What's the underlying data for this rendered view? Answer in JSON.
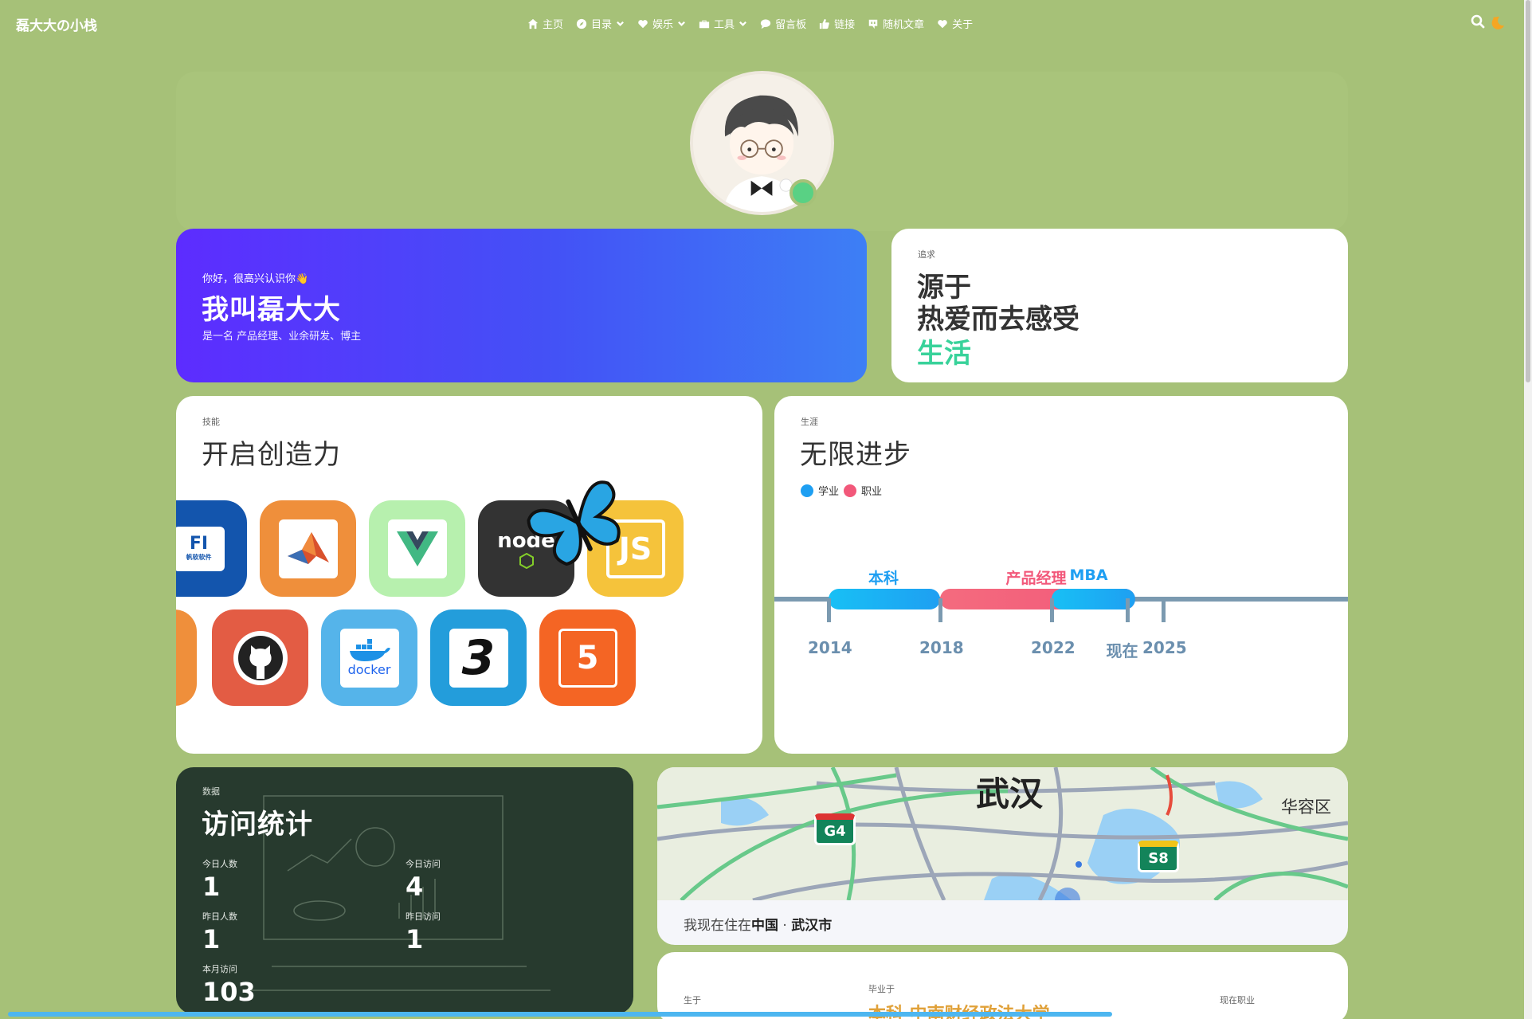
{
  "brand": "磊大大の小栈",
  "menu": [
    {
      "label": "主页",
      "icon": "home-icon",
      "dropdown": false
    },
    {
      "label": "目录",
      "icon": "compass-icon",
      "dropdown": true
    },
    {
      "label": "娱乐",
      "icon": "heart-icon",
      "dropdown": true
    },
    {
      "label": "工具",
      "icon": "toolbox-icon",
      "dropdown": true
    },
    {
      "label": "留言板",
      "icon": "comment-icon",
      "dropdown": false
    },
    {
      "label": "链接",
      "icon": "thumbs-up-icon",
      "dropdown": false
    },
    {
      "label": "随机文章",
      "icon": "random-icon",
      "dropdown": false
    },
    {
      "label": "关于",
      "icon": "heart-icon",
      "dropdown": false
    }
  ],
  "intro": {
    "greeting": "你好，很高兴认识你👋",
    "name": "我叫磊大大",
    "description": "是一名 产品经理、业余研发、博主"
  },
  "pursuit": {
    "tag": "追求",
    "line1": "源于",
    "line2": "热爱而去感受",
    "line3": "生活"
  },
  "skills": {
    "tag": "技能",
    "title": "开启创造力",
    "row1": [
      {
        "name": "FineReport",
        "label": "帆软软件",
        "bg": "#1355ad"
      },
      {
        "name": "MATLAB",
        "label": "",
        "bg": "#ef8f3b"
      },
      {
        "name": "Vue",
        "label": "",
        "bg": "#b7f0ae"
      },
      {
        "name": "Node.js",
        "label": "node",
        "bg": "#333333"
      },
      {
        "name": "JavaScript",
        "label": "JS",
        "bg": "#f5c33b"
      }
    ],
    "row2": [
      {
        "name": "GitHub",
        "label": "",
        "bg": "#e35c44"
      },
      {
        "name": "Docker",
        "label": "docker",
        "bg": "#55b4ea"
      },
      {
        "name": "CSS3",
        "label": "3",
        "bg": "#239ddb"
      },
      {
        "name": "HTML5",
        "label": "5",
        "bg": "#f46524"
      }
    ]
  },
  "career": {
    "tag": "生涯",
    "title": "无限进步",
    "legend": [
      {
        "label": "学业",
        "color": "#1e9ff2"
      },
      {
        "label": "职业",
        "color": "#f2587a"
      }
    ],
    "bars": [
      {
        "label": "本科",
        "type": "学业",
        "start": 2014,
        "end": 2018
      },
      {
        "label": "产品经理",
        "type": "职业",
        "start": 2018,
        "end": 2025
      },
      {
        "label": "MBA",
        "type": "学业",
        "start": 2022,
        "end": 2025
      }
    ],
    "years": [
      "2014",
      "2018",
      "2022",
      "现在",
      "2025"
    ]
  },
  "stats": {
    "tag": "数据",
    "title": "访问统计",
    "today_visitors_label": "今日人数",
    "today_visitors": "1",
    "today_visits_label": "今日访问",
    "today_visits": "4",
    "yesterday_visitors_label": "昨日人数",
    "yesterday_visitors": "1",
    "yesterday_visits_label": "昨日访问",
    "yesterday_visits": "1",
    "month_visits_label": "本月访问",
    "month_visits": "103"
  },
  "map": {
    "city": "武汉",
    "district": "华容区",
    "shield1": "G4",
    "shield2": "S8",
    "location_prefix": "我现在住在",
    "country": "中国",
    "separator": "·",
    "city_full": "武汉市"
  },
  "edu": {
    "born_tag": "生于",
    "grad_tag": "毕业于",
    "school": "本科 中南财经政法大学",
    "job_tag": "现在职业"
  },
  "page_progress": 0.77
}
